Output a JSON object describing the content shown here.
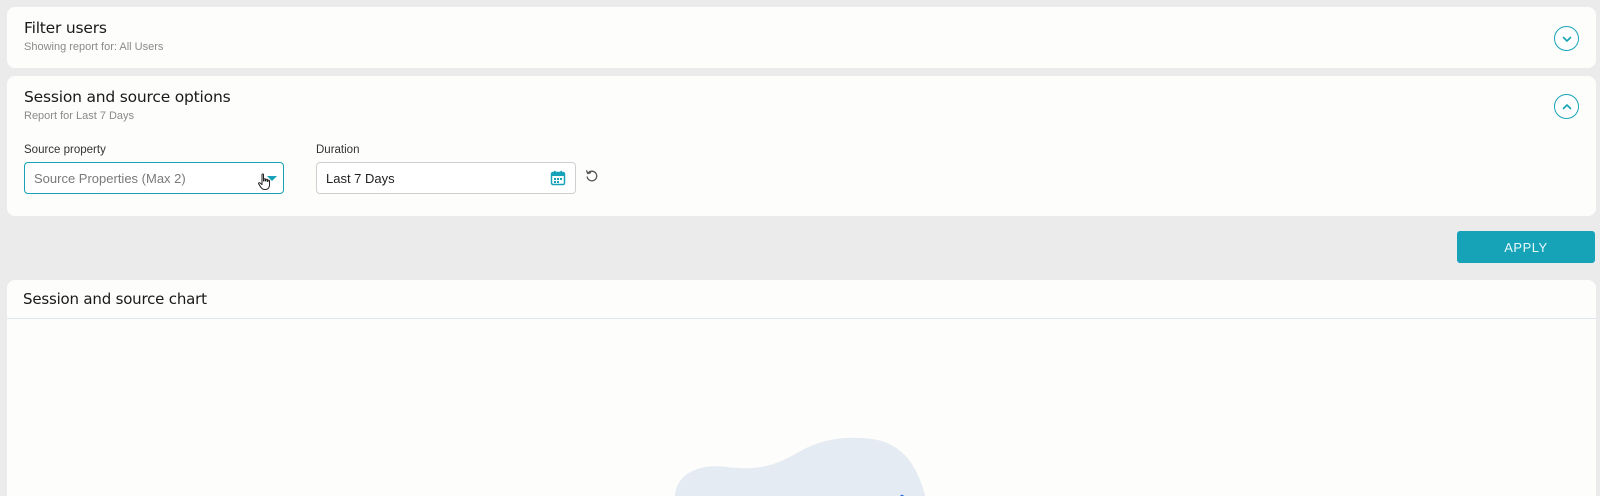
{
  "filter_users": {
    "title": "Filter users",
    "subtitle": "Showing report for: All Users"
  },
  "session_options": {
    "title": "Session and source options",
    "subtitle": "Report for Last 7 Days",
    "source_property": {
      "label": "Source property",
      "placeholder": "Source Properties (Max 2)"
    },
    "duration": {
      "label": "Duration",
      "value": "Last 7 Days"
    }
  },
  "apply_label": "APPLY",
  "chart_section": {
    "title": "Session and source chart"
  },
  "colors": {
    "accent": "#16a3b8",
    "background": "#ebebeb",
    "card": "#fdfdfb",
    "illustration_blob": "#e5ebf3"
  },
  "icons": [
    "chevron-down-icon",
    "chevron-up-icon",
    "dropdown-caret-icon",
    "hand-cursor-icon",
    "calendar-icon",
    "reset-icon"
  ]
}
